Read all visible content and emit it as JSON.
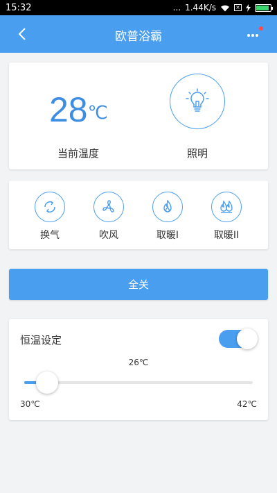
{
  "status_bar": {
    "time": "15:32",
    "dots": "...",
    "network_speed": "1.44K/s",
    "icons": [
      "wifi-icon",
      "sim-blocked-icon",
      "charging-icon",
      "battery-icon"
    ],
    "battery_level": 0.9
  },
  "header": {
    "title": "欧普浴霸",
    "icons": [
      "back-arrow-icon",
      "more-icon"
    ],
    "notification_color": "#ff4a4a"
  },
  "current": {
    "temperature": "28",
    "unit": "℃",
    "temperature_label": "当前温度",
    "light_label": "照明",
    "light_icon": "light-bulb-icon"
  },
  "modes": [
    {
      "label": "换气",
      "icon": "ventilation-icon"
    },
    {
      "label": "吹风",
      "icon": "fan-icon"
    },
    {
      "label": "取暖I",
      "icon": "heat-low-icon"
    },
    {
      "label": "取暖II",
      "icon": "heat-high-icon"
    }
  ],
  "all_off_label": "全关",
  "thermostat": {
    "title": "恒温设定",
    "enabled": true,
    "value_label": "26℃",
    "value": 26,
    "min": 30,
    "max": 42,
    "min_label": "30℃",
    "max_label": "42℃",
    "slider_fraction": 0.1
  },
  "colors": {
    "accent": "#4a9ef0",
    "temperature_text": "#3d8de4",
    "background": "#f2f3f5"
  }
}
